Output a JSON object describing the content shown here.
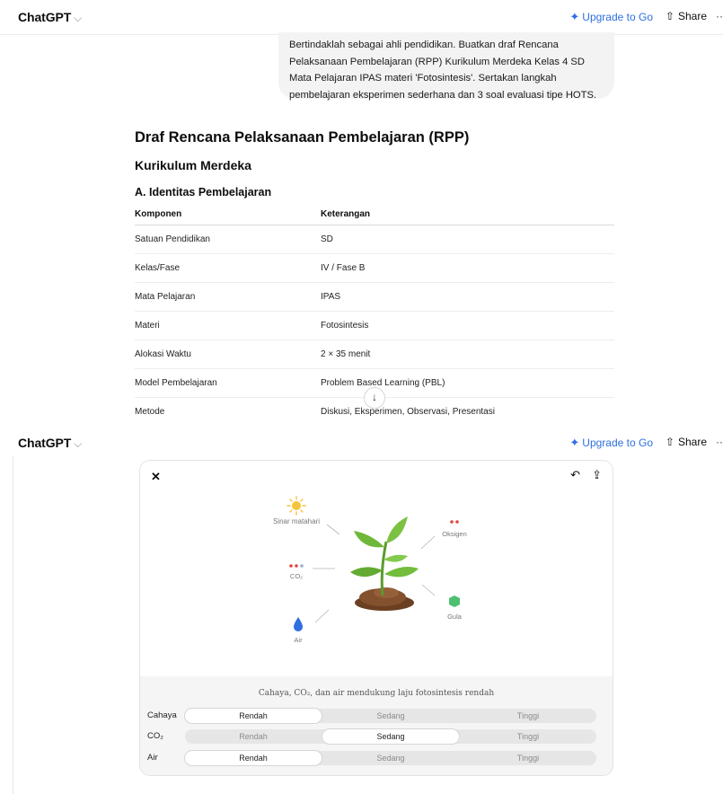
{
  "header": {
    "brand": "ChatGPT",
    "upgrade_label": "Upgrade to Go",
    "share_label": "Share"
  },
  "prompt": "Bertindaklah sebagai ahli pendidikan. Buatkan draf Rencana Pelaksanaan Pembelajaran (RPP) Kurikulum Merdeka Kelas 4 SD Mata Pelajaran IPAS materi 'Fotosintesis'. Sertakan langkah pembelajaran eksperimen sederhana dan 3 soal evaluasi tipe HOTS.",
  "doc": {
    "title": "Draf Rencana Pelaksanaan Pembelajaran (RPP)",
    "subtitle": "Kurikulum Merdeka",
    "section": "A. Identitas Pembelajaran",
    "table": {
      "headers": [
        "Komponen",
        "Keterangan"
      ],
      "rows": [
        [
          "Satuan Pendidikan",
          "SD"
        ],
        [
          "Kelas/Fase",
          "IV / Fase B"
        ],
        [
          "Mata Pelajaran",
          "IPAS"
        ],
        [
          "Materi",
          "Fotosintesis"
        ],
        [
          "Alokasi Waktu",
          "2 × 35 menit"
        ],
        [
          "Model Pembelajaran",
          "Problem Based Learning (PBL)"
        ],
        [
          "Metode",
          "Diskusi, Eksperimen, Observasi, Presentasi"
        ]
      ]
    }
  },
  "illustration": {
    "labels": {
      "sun": "Sinar matahari",
      "co2": "CO₂",
      "water": "Air",
      "oxygen": "Oksigen",
      "sugar": "Gula"
    },
    "caption": "Cahaya, CO₂, dan air mendukung laju fotosintesis rendah",
    "controls": [
      {
        "label": "Cahaya",
        "options": [
          "Rendah",
          "Sedang",
          "Tinggi"
        ],
        "selected": 0
      },
      {
        "label": "CO₂",
        "options": [
          "Rendah",
          "Sedang",
          "Tinggi"
        ],
        "selected": 1
      },
      {
        "label": "Air",
        "options": [
          "Rendah",
          "Sedang",
          "Tinggi"
        ],
        "selected": 0
      }
    ]
  },
  "colors": {
    "accent": "#2f6fe0",
    "leaf": "#6fb83a",
    "soil": "#7a4a2a",
    "sun": "#f5c33b",
    "co2_dot": "#e0463c",
    "water": "#2f6fe0",
    "sugar": "#4cc070"
  }
}
